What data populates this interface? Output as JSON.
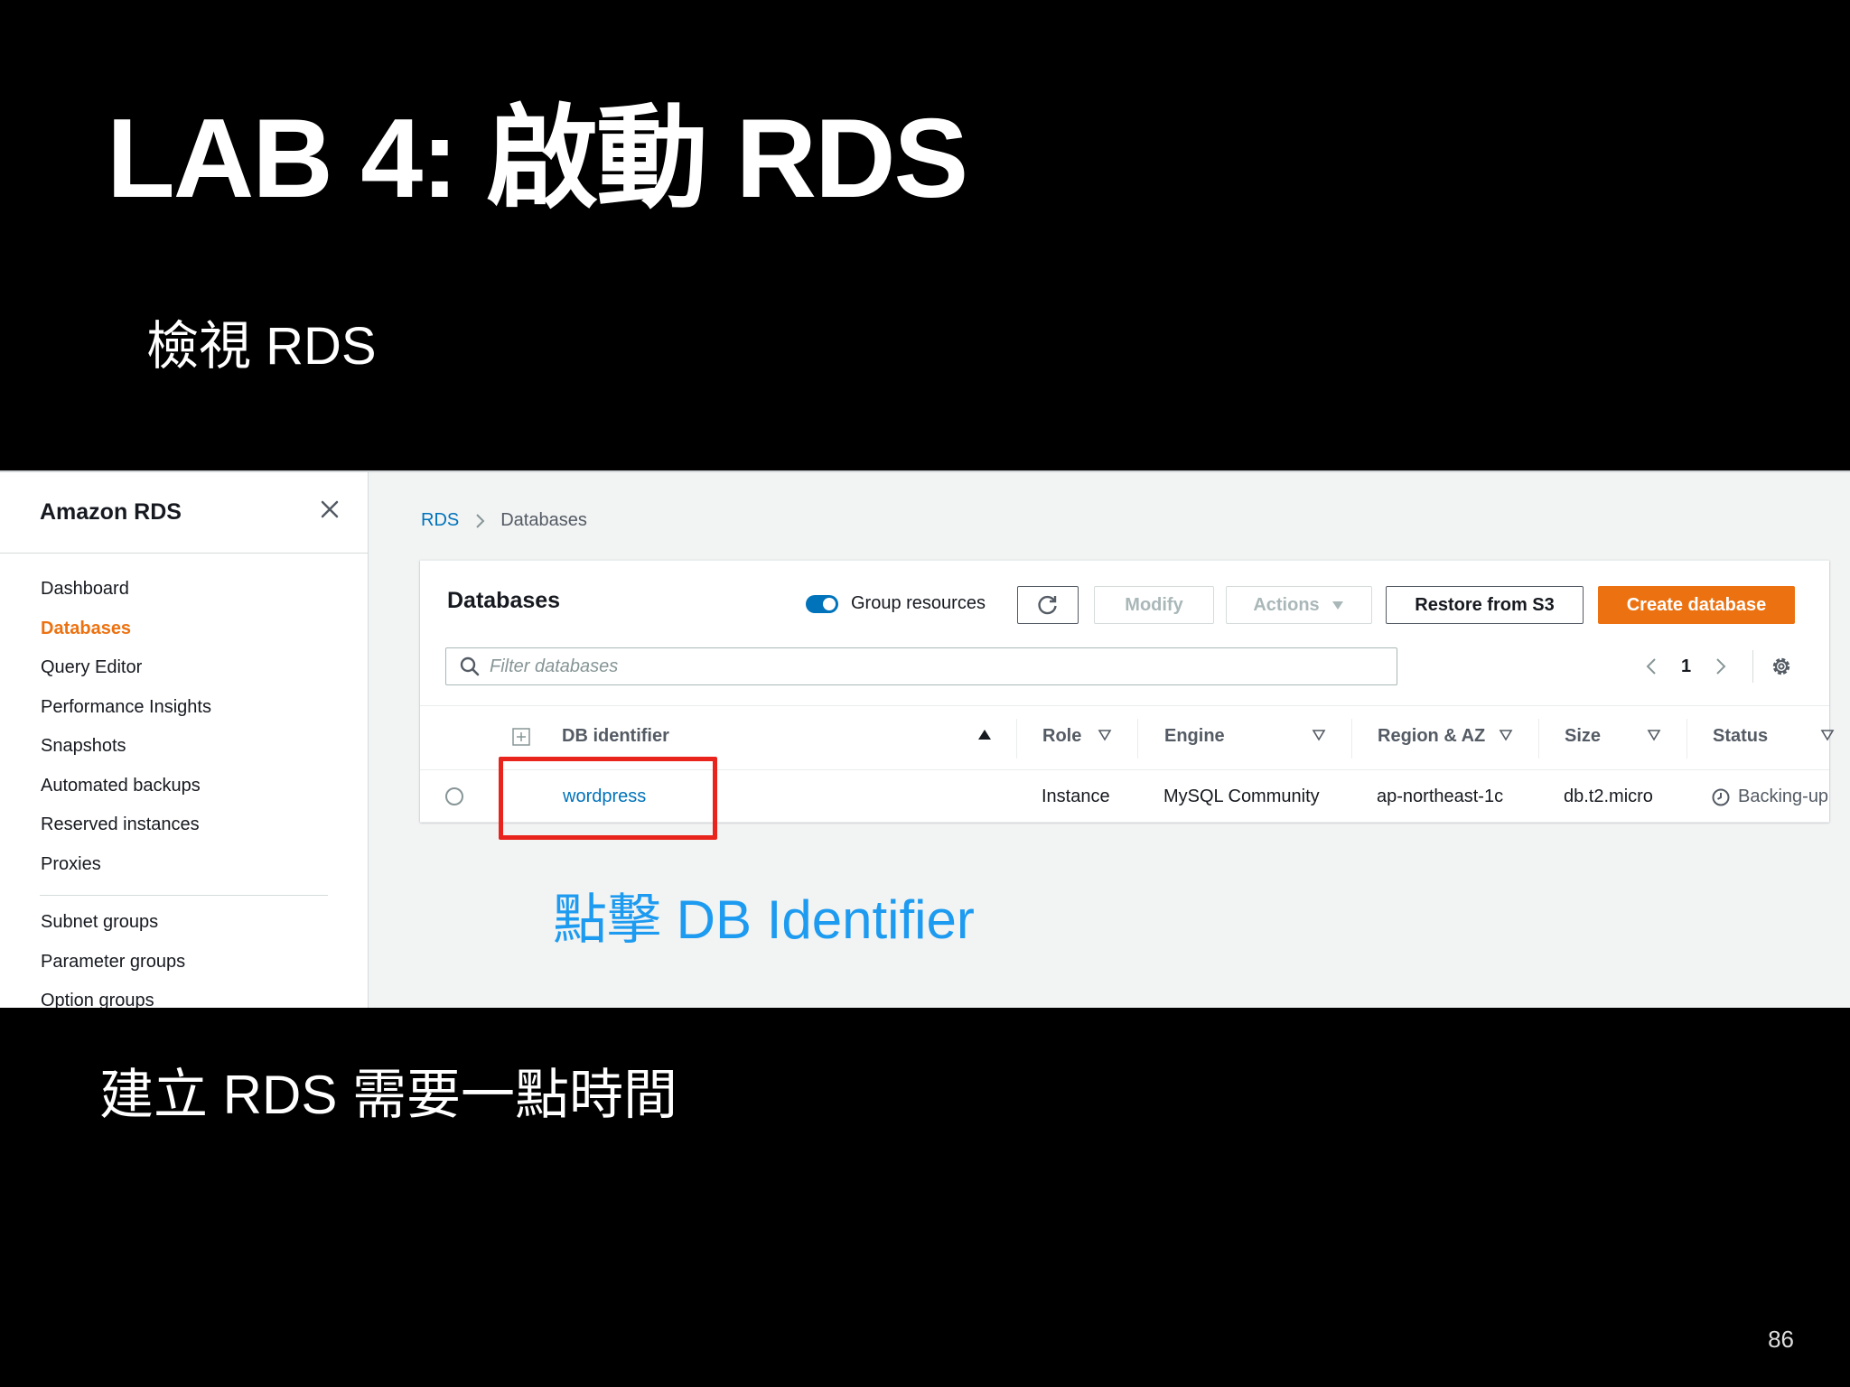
{
  "slide": {
    "title": "LAB 4: 啟動 RDS",
    "subtitle": "檢視 RDS",
    "note": "建立 RDS 需要一點時間",
    "page_number": "86",
    "annotation": "點擊 DB Identifier"
  },
  "sidebar": {
    "title": "Amazon RDS",
    "items_group1": [
      {
        "label": "Dashboard"
      },
      {
        "label": "Databases",
        "active": true
      },
      {
        "label": "Query Editor"
      },
      {
        "label": "Performance Insights"
      },
      {
        "label": "Snapshots"
      },
      {
        "label": "Automated backups"
      },
      {
        "label": "Reserved instances"
      },
      {
        "label": "Proxies"
      }
    ],
    "items_group2": [
      {
        "label": "Subnet groups"
      },
      {
        "label": "Parameter groups"
      },
      {
        "label": "Option groups"
      }
    ]
  },
  "breadcrumb": {
    "root": "RDS",
    "current": "Databases"
  },
  "panel": {
    "title": "Databases",
    "group_resources_label": "Group resources",
    "group_resources_on": true,
    "modify_label": "Modify",
    "actions_label": "Actions",
    "restore_label": "Restore from S3",
    "create_label": "Create database",
    "search_placeholder": "Filter databases",
    "page": "1"
  },
  "table": {
    "columns": [
      "DB identifier",
      "Role",
      "Engine",
      "Region & AZ",
      "Size",
      "Status"
    ],
    "rows": [
      {
        "db_identifier": "wordpress",
        "role": "Instance",
        "engine": "MySQL Community",
        "region": "ap-northeast-1c",
        "size": "db.t2.micro",
        "status": "Backing-up"
      }
    ]
  },
  "colors": {
    "accent_orange": "#ec7211",
    "link_blue": "#0073bb",
    "annotation_blue": "#1d9bf0",
    "highlight_red": "#e8241c"
  }
}
